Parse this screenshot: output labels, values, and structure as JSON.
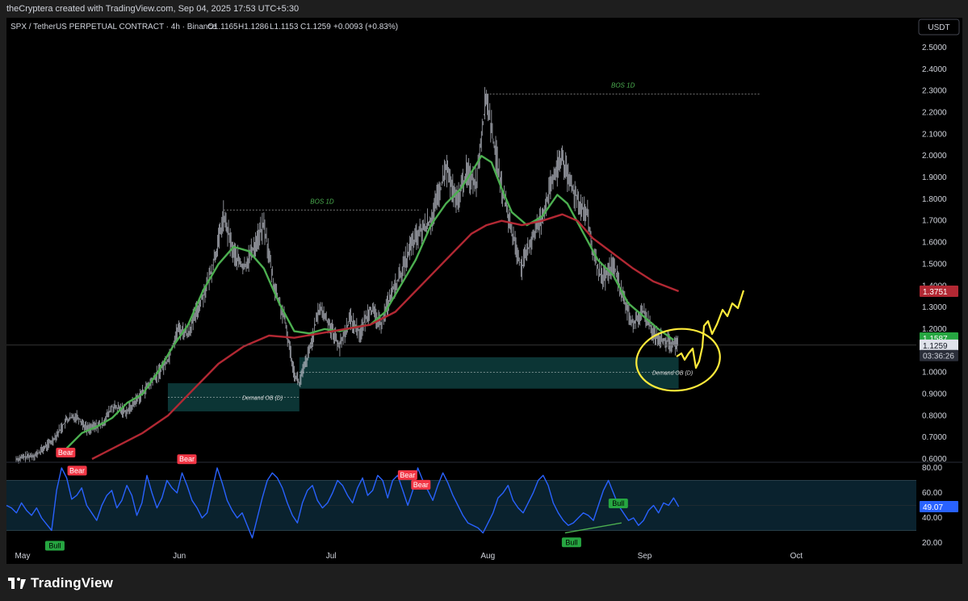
{
  "header": {
    "attribution": "theCryptera created with TradingView.com, Sep 04, 2025 17:53 UTC+5:30"
  },
  "legend": {
    "symbol": "SPX / TetherUS PERPETUAL CONTRACT · 4h · Binance",
    "open": "O1.1165",
    "high": "H1.1286",
    "low": "L1.1153",
    "close": "C1.1259",
    "change": "+0.0093 (+0.83%)"
  },
  "currency_button": "USDT",
  "footer": {
    "brand": "TradingView"
  },
  "colors": {
    "background": "#000000",
    "candles": "#b2b5be",
    "ema_fast": "#4caf50",
    "ema_slow": "#b22833",
    "rsi": "#2962ff",
    "zone": "#0d3b3b",
    "marker": "#ffeb3b",
    "bear": "#f23645",
    "bull": "#26a641"
  },
  "chart_data": {
    "type": "line",
    "title": "SPX / TetherUS PERPETUAL CONTRACT · 4h · Binance",
    "price_ticks": [
      "2.5000",
      "2.4000",
      "2.3000",
      "2.2000",
      "2.1000",
      "2.0000",
      "1.9000",
      "1.8000",
      "1.7000",
      "1.6000",
      "1.5000",
      "1.4000",
      "1.3000",
      "1.2000",
      "1.1000",
      "1.0000",
      "0.9000",
      "0.8000",
      "0.7000",
      "0.6000"
    ],
    "ylim": [
      0.58,
      2.55
    ],
    "x_ticks": [
      {
        "label": "May",
        "day": 0
      },
      {
        "label": "Jun",
        "day": 31
      },
      {
        "label": "Jul",
        "day": 61
      },
      {
        "label": "Aug",
        "day": 92
      },
      {
        "label": "Sep",
        "day": 123
      },
      {
        "label": "Oct",
        "day": 153
      }
    ],
    "xlim_days": [
      0,
      178
    ],
    "price_path": [
      [
        0,
        0.6
      ],
      [
        4,
        0.62
      ],
      [
        7,
        0.68
      ],
      [
        10,
        0.78
      ],
      [
        12,
        0.8
      ],
      [
        14,
        0.74
      ],
      [
        17,
        0.76
      ],
      [
        19,
        0.84
      ],
      [
        22,
        0.82
      ],
      [
        24,
        0.88
      ],
      [
        27,
        0.96
      ],
      [
        30,
        1.06
      ],
      [
        32,
        1.2
      ],
      [
        34,
        1.18
      ],
      [
        36,
        1.3
      ],
      [
        38,
        1.42
      ],
      [
        40,
        1.6
      ],
      [
        41,
        1.72
      ],
      [
        43,
        1.55
      ],
      [
        45,
        1.48
      ],
      [
        47,
        1.58
      ],
      [
        49,
        1.68
      ],
      [
        51,
        1.4
      ],
      [
        53,
        1.25
      ],
      [
        55,
        1.0
      ],
      [
        56,
        0.95
      ],
      [
        58,
        1.1
      ],
      [
        60,
        1.3
      ],
      [
        62,
        1.22
      ],
      [
        64,
        1.12
      ],
      [
        66,
        1.25
      ],
      [
        68,
        1.18
      ],
      [
        70,
        1.3
      ],
      [
        72,
        1.22
      ],
      [
        74,
        1.35
      ],
      [
        76,
        1.45
      ],
      [
        78,
        1.58
      ],
      [
        80,
        1.65
      ],
      [
        82,
        1.7
      ],
      [
        84,
        1.85
      ],
      [
        85,
        1.95
      ],
      [
        87,
        1.78
      ],
      [
        89,
        1.92
      ],
      [
        91,
        1.88
      ],
      [
        92,
        2.1
      ],
      [
        93,
        2.28
      ],
      [
        94,
        2.12
      ],
      [
        96,
        1.85
      ],
      [
        98,
        1.65
      ],
      [
        100,
        1.48
      ],
      [
        102,
        1.62
      ],
      [
        104,
        1.72
      ],
      [
        106,
        1.88
      ],
      [
        108,
        2.0
      ],
      [
        109,
        1.9
      ],
      [
        111,
        1.8
      ],
      [
        113,
        1.72
      ],
      [
        114,
        1.55
      ],
      [
        116,
        1.42
      ],
      [
        118,
        1.5
      ],
      [
        120,
        1.35
      ],
      [
        122,
        1.22
      ],
      [
        124,
        1.28
      ],
      [
        126,
        1.18
      ],
      [
        128,
        1.15
      ],
      [
        130,
        1.13
      ],
      [
        131,
        1.126
      ]
    ],
    "series": [
      {
        "name": "",
        "color": "#4caf50",
        "points": [
          [
            10,
            0.65
          ],
          [
            13,
            0.72
          ],
          [
            16,
            0.75
          ],
          [
            19,
            0.79
          ],
          [
            22,
            0.86
          ],
          [
            25,
            0.9
          ],
          [
            28,
            1.0
          ],
          [
            31,
            1.12
          ],
          [
            34,
            1.22
          ],
          [
            37,
            1.38
          ],
          [
            40,
            1.5
          ],
          [
            43,
            1.58
          ],
          [
            46,
            1.56
          ],
          [
            49,
            1.48
          ],
          [
            52,
            1.32
          ],
          [
            55,
            1.19
          ],
          [
            58,
            1.18
          ],
          [
            61,
            1.2
          ],
          [
            64,
            1.19
          ],
          [
            67,
            1.21
          ],
          [
            70,
            1.22
          ],
          [
            73,
            1.28
          ],
          [
            76,
            1.4
          ],
          [
            79,
            1.52
          ],
          [
            82,
            1.68
          ],
          [
            85,
            1.78
          ],
          [
            88,
            1.85
          ],
          [
            91,
            1.96
          ],
          [
            92,
            2.0
          ],
          [
            94,
            1.97
          ],
          [
            96,
            1.85
          ],
          [
            98,
            1.74
          ],
          [
            101,
            1.68
          ],
          [
            104,
            1.72
          ],
          [
            107,
            1.82
          ],
          [
            109,
            1.78
          ],
          [
            112,
            1.65
          ],
          [
            115,
            1.52
          ],
          [
            118,
            1.45
          ],
          [
            121,
            1.32
          ],
          [
            124,
            1.26
          ],
          [
            127,
            1.2
          ],
          [
            130,
            1.15
          ]
        ]
      },
      {
        "name": "",
        "color": "#b22833",
        "points": [
          [
            15,
            0.6
          ],
          [
            20,
            0.66
          ],
          [
            25,
            0.72
          ],
          [
            30,
            0.8
          ],
          [
            35,
            0.92
          ],
          [
            40,
            1.04
          ],
          [
            45,
            1.12
          ],
          [
            50,
            1.17
          ],
          [
            55,
            1.16
          ],
          [
            60,
            1.18
          ],
          [
            65,
            1.2
          ],
          [
            70,
            1.22
          ],
          [
            75,
            1.28
          ],
          [
            80,
            1.4
          ],
          [
            85,
            1.52
          ],
          [
            90,
            1.64
          ],
          [
            93,
            1.68
          ],
          [
            96,
            1.7
          ],
          [
            100,
            1.68
          ],
          [
            104,
            1.7
          ],
          [
            108,
            1.73
          ],
          [
            111,
            1.7
          ],
          [
            114,
            1.62
          ],
          [
            118,
            1.55
          ],
          [
            122,
            1.48
          ],
          [
            126,
            1.42
          ],
          [
            131,
            1.375
          ]
        ]
      }
    ],
    "annotations": {
      "bos_1": {
        "label": "BOS 1D",
        "price": 1.75,
        "from_day": 41,
        "to_day": 80
      },
      "bos_2": {
        "label": "BOS 1D",
        "price": 2.285,
        "from_day": 93,
        "to_day": 147
      },
      "demand_1": {
        "label": "Demand OB (D)",
        "top": 0.95,
        "bottom": 0.82,
        "from_day": 30,
        "to_day": 56,
        "mid": 0.885
      },
      "demand_2": {
        "label": "Demand OB (D)",
        "top": 1.07,
        "bottom": 0.925,
        "from_day": 56,
        "to_day": 131,
        "mid": 1.0
      }
    },
    "price_labels": [
      {
        "value": "1.3751",
        "price": 1.3751,
        "color": "#b22833"
      },
      {
        "value": "1.1587",
        "price": 1.1587,
        "color": "#26a641"
      },
      {
        "value": "1.1259",
        "price": 1.1259,
        "color": "#d1d4dc"
      },
      {
        "value": "03:36:26",
        "price": 1.0779,
        "color": "#d1d4dc"
      }
    ],
    "rsi": {
      "ticks": [
        "80.00",
        "60.00",
        "40.00",
        "20.00"
      ],
      "ylim": [
        15,
        82
      ],
      "band": [
        70,
        30
      ],
      "last": "49.07",
      "values": [
        50,
        48,
        44,
        52,
        46,
        42,
        48,
        40,
        35,
        30,
        62,
        80,
        72,
        55,
        58,
        64,
        50,
        44,
        38,
        50,
        58,
        62,
        48,
        54,
        66,
        58,
        42,
        52,
        74,
        60,
        48,
        56,
        70,
        64,
        60,
        76,
        66,
        54,
        48,
        40,
        44,
        62,
        80,
        68,
        54,
        46,
        40,
        44,
        34,
        24,
        40,
        56,
        70,
        76,
        72,
        64,
        52,
        42,
        36,
        52,
        62,
        66,
        54,
        48,
        52,
        60,
        70,
        66,
        58,
        52,
        64,
        72,
        58,
        62,
        74,
        70,
        56,
        70,
        74,
        62,
        50,
        62,
        80,
        70,
        62,
        54,
        66,
        76,
        68,
        58,
        50,
        42,
        36,
        34,
        32,
        28,
        36,
        44,
        56,
        60,
        66,
        54,
        48,
        44,
        52,
        60,
        70,
        74,
        66,
        52,
        44,
        38,
        34,
        36,
        40,
        44,
        42,
        38,
        50,
        62,
        70,
        60,
        50,
        44,
        38,
        40,
        34,
        38,
        46,
        50,
        44,
        52,
        50,
        56,
        49
      ],
      "labels": [
        {
          "text": "Bear",
          "type": "bear",
          "i": 11
        },
        {
          "text": "Bear",
          "type": "bear",
          "i": 12
        },
        {
          "text": "Bull",
          "type": "bull",
          "i": 9
        },
        {
          "text": "Bear",
          "type": "bear",
          "i": 35
        },
        {
          "text": "Bear",
          "type": "bear",
          "i": 79
        },
        {
          "text": "Bear",
          "type": "bear",
          "i": 81
        },
        {
          "text": "Bull",
          "type": "bull",
          "i": 112
        },
        {
          "text": "Bull",
          "type": "bull",
          "i": 121
        }
      ]
    }
  }
}
